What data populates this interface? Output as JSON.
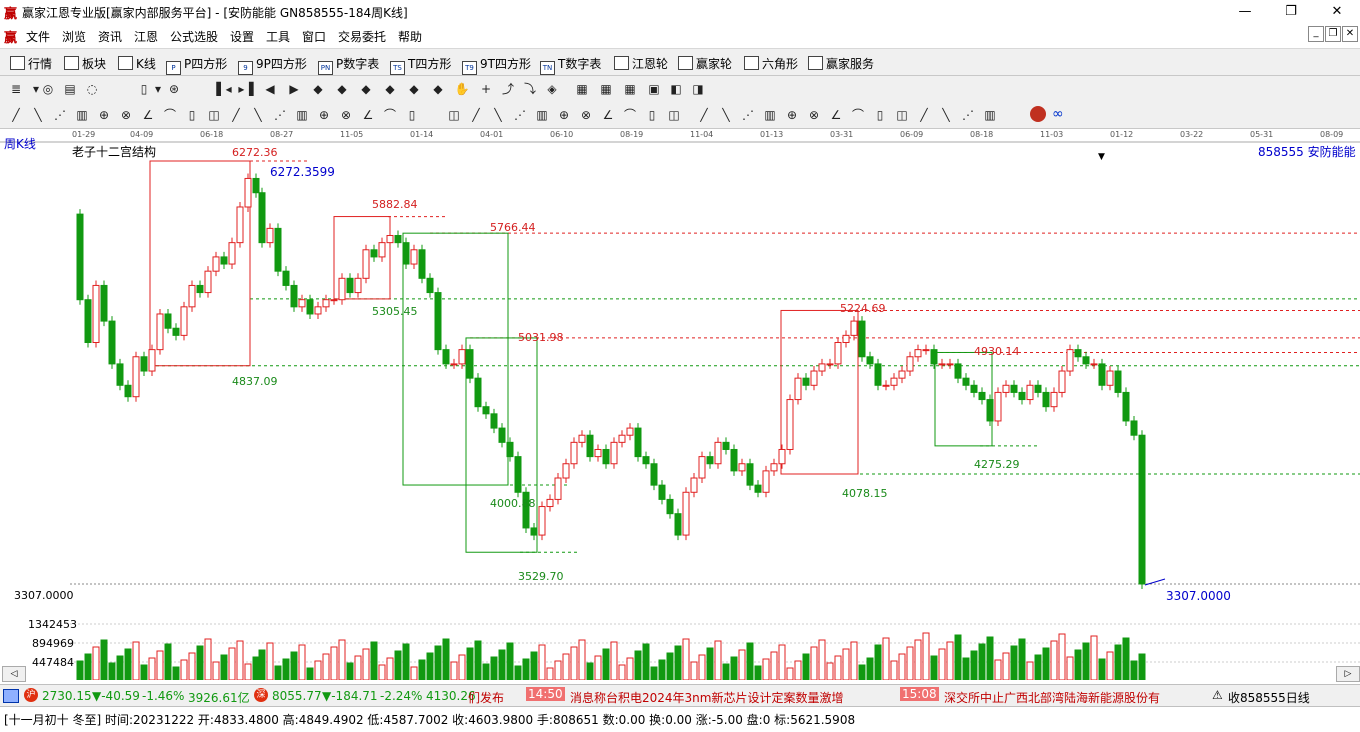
{
  "window": {
    "title": "赢家江恩专业版[赢家内部服务平台] - [安防能能  GN858555-184周K线]",
    "minimize": "—",
    "maximize": "❐",
    "close": "✕"
  },
  "menu": [
    "文件",
    "浏览",
    "资讯",
    "江恩",
    "公式选股",
    "设置",
    "工具",
    "窗口",
    "交易委托",
    "帮助"
  ],
  "mdi_controls": [
    "_",
    "❐",
    "✕"
  ],
  "nav": [
    {
      "icon": "grid-icon",
      "label": "行情"
    },
    {
      "icon": "blocks-icon",
      "label": "板块"
    },
    {
      "icon": "candle-icon",
      "label": "K线"
    },
    {
      "icon": "P",
      "label": "P四方形"
    },
    {
      "icon": "9",
      "label": "9P四方形"
    },
    {
      "icon": "PN",
      "label": "P数字表"
    },
    {
      "icon": "TS",
      "label": "T四方形"
    },
    {
      "icon": "T9",
      "label": "9T四方形"
    },
    {
      "icon": "TN",
      "label": "T数字表"
    },
    {
      "icon": "wheel-icon",
      "label": "江恩轮"
    },
    {
      "icon": "wheel2-icon",
      "label": "赢家轮"
    },
    {
      "icon": "hexagon-icon",
      "label": "六角形"
    },
    {
      "icon": "dollar-icon",
      "label": "赢家服务"
    }
  ],
  "chart": {
    "period_label": "周K线",
    "indicator_label": "老子十二宫结构",
    "stock_label": "858555  安防能能",
    "price_axis_label": "3307.0000",
    "last_price_label": "3307.0000",
    "cursor_price": "6272.3599",
    "dates": [
      "01-29",
      "04-09",
      "06-18",
      "08-27",
      "11-05",
      "01-14",
      "04-01",
      "06-10",
      "08-19",
      "11-04",
      "01-13",
      "03-31",
      "06-09",
      "08-18",
      "11-03",
      "01-12",
      "03-22",
      "05-31",
      "08-09"
    ],
    "levels": [
      {
        "text": "6272.36",
        "color": "#d42020"
      },
      {
        "text": "5882.84",
        "color": "#d42020"
      },
      {
        "text": "5766.44",
        "color": "#d42020"
      },
      {
        "text": "5305.45",
        "color": "#1a8a1a"
      },
      {
        "text": "5224.69",
        "color": "#d42020"
      },
      {
        "text": "5031.98",
        "color": "#d42020"
      },
      {
        "text": "4930.14",
        "color": "#d42020"
      },
      {
        "text": "4837.09",
        "color": "#1a8a1a"
      },
      {
        "text": "4275.29",
        "color": "#1a8a1a"
      },
      {
        "text": "4078.15",
        "color": "#1a8a1a"
      },
      {
        "text": "4000.88",
        "color": "#1a8a1a"
      },
      {
        "text": "3529.70",
        "color": "#1a8a1a"
      }
    ],
    "volume_axis": [
      "1342453",
      "894969",
      "447484"
    ],
    "colors": {
      "up": "#e02020",
      "down": "#119911",
      "grid": "#cccccc"
    }
  },
  "status": {
    "idx1_value": "2730.15",
    "idx1_change": "▼-40.59",
    "idx1_pct": "-1.46%",
    "idx1_amount": "3926.61亿",
    "idx2_value": "8055.77",
    "idx2_change": "▼-184.71",
    "idx2_pct": "-2.24%",
    "idx2_amount": "4130.26",
    "news_prefix": "们发布",
    "news1_time": "14:50",
    "news1_text": "消息称台积电2024年3nm新芯片设计定案数量激增",
    "news2_time": "15:08",
    "news2_text": "深交所中止广西北部湾陆海新能源股份有",
    "right_text": "收858555日线"
  },
  "info": {
    "text": "[十一月初十 冬至] 时间:20231222 开:4833.4800 高:4849.4902 低:4587.7002 收:4603.9800 手:808651 数:0.00 换:0.00 涨:-5.00 盘:0 标:5621.5908"
  }
}
